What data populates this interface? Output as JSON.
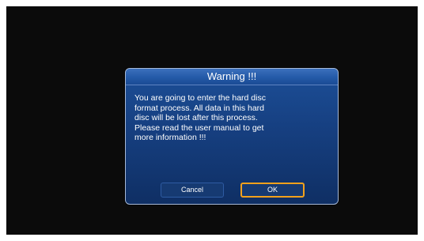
{
  "dialog": {
    "title": "Warning !!!",
    "message": "You are going to enter the hard disc\nformat process. All data in this hard\ndisc will be lost after this process.\nPlease read the user manual to get\nmore information !!!",
    "buttons": {
      "cancel_label": "Cancel",
      "ok_label": "OK",
      "focused": "OK"
    }
  },
  "colors": {
    "screen_background": "#0b0b0b",
    "dialog_background": "#163f80",
    "title_bar": "#245aa8",
    "focus_border": "#f2a11c",
    "text": "#ffffff"
  }
}
